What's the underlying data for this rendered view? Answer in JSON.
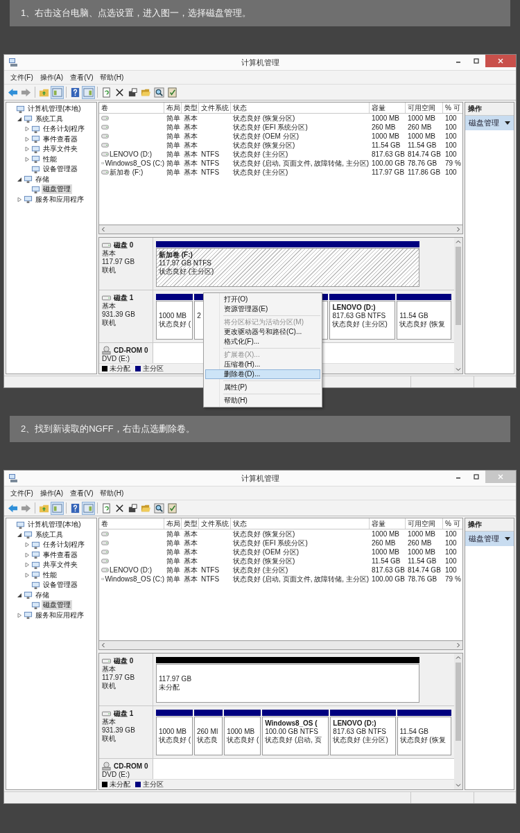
{
  "steps": [
    {
      "instruction": "1、右击这台电脑、点选设置，进入图一，选择磁盘管理。",
      "window": {
        "title": "计算机管理",
        "active": true,
        "menu_bar": [
          "文件(F)",
          "操作(A)",
          "查看(V)",
          "帮助(H)"
        ],
        "tree": [
          {
            "label": "计算机管理(本地)",
            "selected": false,
            "children": [
              {
                "label": "系统工具",
                "selected": false,
                "expanded": true,
                "children": [
                  {
                    "label": "任务计划程序",
                    "selected": false,
                    "expanded": false
                  },
                  {
                    "label": "事件查看器",
                    "selected": false,
                    "expanded": false
                  },
                  {
                    "label": "共享文件夹",
                    "selected": false,
                    "expanded": false
                  },
                  {
                    "label": "性能",
                    "selected": false,
                    "expanded": false
                  },
                  {
                    "label": "设备管理器",
                    "selected": false
                  }
                ]
              },
              {
                "label": "存储",
                "selected": false,
                "expanded": true,
                "children": [
                  {
                    "label": "磁盘管理",
                    "selected": true
                  }
                ]
              },
              {
                "label": "服务和应用程序",
                "selected": false,
                "expanded": false
              }
            ]
          }
        ],
        "volume_table": {
          "columns": [
            "卷",
            "布局",
            "类型",
            "文件系统",
            "状态",
            "容量",
            "可用空间",
            "% 可"
          ],
          "rows": [
            {
              "layout": "简单",
              "type": "基本",
              "status": "状态良好 (恢复分区)",
              "capacity": "1000 MB",
              "free_space": "1000 MB",
              "percent_free": "100"
            },
            {
              "layout": "简单",
              "type": "基本",
              "status": "状态良好 (EFI 系统分区)",
              "capacity": "260 MB",
              "free_space": "260 MB",
              "percent_free": "100"
            },
            {
              "layout": "简单",
              "type": "基本",
              "status": "状态良好 (OEM 分区)",
              "capacity": "1000 MB",
              "free_space": "1000 MB",
              "percent_free": "100"
            },
            {
              "layout": "简单",
              "type": "基本",
              "status": "状态良好 (恢复分区)",
              "capacity": "11.54 GB",
              "free_space": "11.54 GB",
              "percent_free": "100"
            },
            {
              "volume": "LENOVO (D:)",
              "layout": "简单",
              "type": "基本",
              "file_system": "NTFS",
              "status": "状态良好 (主分区)",
              "capacity": "817.63 GB",
              "free_space": "814.74 GB",
              "percent_free": "100"
            },
            {
              "volume": "Windows8_OS (C:)",
              "layout": "简单",
              "type": "基本",
              "file_system": "NTFS",
              "status": "状态良好 (启动, 页面文件, 故障转储, 主分区)",
              "capacity": "100.00 GB",
              "free_space": "78.76 GB",
              "percent_free": "79 %"
            },
            {
              "volume": "新加卷 (F:)",
              "layout": "简单",
              "type": "基本",
              "file_system": "NTFS",
              "status": "状态良好 (主分区)",
              "capacity": "117.97 GB",
              "free_space": "117.86 GB",
              "percent_free": "100"
            }
          ]
        },
        "disks": [
          {
            "kind": "disk",
            "name": "磁盘 0",
            "lines": [
              "基本",
              "117.97 GB",
              "联机"
            ],
            "partitions": [
              {
                "color": "#00007f",
                "selected": true,
                "title": "新加卷  (F:)",
                "lines": [
                  "117.97 GB NTFS",
                  "状态良好 (主分区)"
                ]
              }
            ]
          },
          {
            "kind": "disk",
            "name": "磁盘 1",
            "lines": [
              "基本",
              "931.39 GB",
              "联机"
            ],
            "partitions": [
              {
                "color": "#00007f",
                "selected": false,
                "lines": [
                  "1000 MB",
                  "状态良好 ("
                ]
              },
              {
                "color": "#00007f",
                "selected": false,
                "lines": [
                  "2"
                ]
              },
              {
                "color": "#00007f",
                "selected": false
              },
              {
                "color": "#00007f",
                "selected": false,
                "title": "LENOVO  (D:)",
                "lines": [
                  "817.63 GB NTFS",
                  "状态良好 (主分区)"
                ]
              },
              {
                "color": "#00007f",
                "selected": false,
                "lines": [
                  "11.54 GB",
                  "状态良好 (恢复"
                ]
              }
            ]
          },
          {
            "kind": "cdrom",
            "name": "CD-ROM 0",
            "lines": [
              "DVD (E:)"
            ]
          }
        ],
        "legend": [
          {
            "label": "未分配",
            "color": "#000000"
          },
          {
            "label": "主分区",
            "color": "#00007f"
          }
        ],
        "actions": {
          "header": "操作",
          "item": "磁盘管理"
        },
        "context_menu": {
          "items": [
            {
              "label": "打开(O)",
              "disabled": false,
              "selected": false
            },
            {
              "label": "资源管理器(E)",
              "disabled": false,
              "selected": false,
              "separator_after": true
            },
            {
              "label": "将分区标记为活动分区(M)",
              "disabled": true,
              "selected": false
            },
            {
              "label": "更改驱动器号和路径(C)...",
              "disabled": false,
              "selected": false
            },
            {
              "label": "格式化(F)...",
              "disabled": false,
              "selected": false,
              "separator_after": true
            },
            {
              "label": "扩展卷(X)...",
              "disabled": true,
              "selected": false
            },
            {
              "label": "压缩卷(H)...",
              "disabled": false,
              "selected": false
            },
            {
              "label": "删除卷(D)...",
              "disabled": false,
              "selected": true,
              "separator_after": true
            },
            {
              "label": "属性(P)",
              "disabled": false,
              "selected": false,
              "separator_after": true
            },
            {
              "label": "帮助(H)",
              "disabled": false,
              "selected": false
            }
          ]
        }
      }
    },
    {
      "instruction": "2、找到新读取的NGFF，右击点选删除卷。",
      "window": {
        "title": "计算机管理",
        "active": false,
        "menu_bar": [
          "文件(F)",
          "操作(A)",
          "查看(V)",
          "帮助(H)"
        ],
        "tree": [
          {
            "label": "计算机管理(本地)",
            "selected": false,
            "children": [
              {
                "label": "系统工具",
                "selected": false,
                "expanded": true,
                "children": [
                  {
                    "label": "任务计划程序",
                    "selected": false,
                    "expanded": false
                  },
                  {
                    "label": "事件查看器",
                    "selected": false,
                    "expanded": false
                  },
                  {
                    "label": "共享文件夹",
                    "selected": false,
                    "expanded": false
                  },
                  {
                    "label": "性能",
                    "selected": false,
                    "expanded": false
                  },
                  {
                    "label": "设备管理器",
                    "selected": false
                  }
                ]
              },
              {
                "label": "存储",
                "selected": false,
                "expanded": true,
                "children": [
                  {
                    "label": "磁盘管理",
                    "selected": true
                  }
                ]
              },
              {
                "label": "服务和应用程序",
                "selected": false,
                "expanded": false
              }
            ]
          }
        ],
        "volume_table": {
          "columns": [
            "卷",
            "布局",
            "类型",
            "文件系统",
            "状态",
            "容量",
            "可用空间",
            "% 可"
          ],
          "rows": [
            {
              "layout": "简单",
              "type": "基本",
              "status": "状态良好 (恢复分区)",
              "capacity": "1000 MB",
              "free_space": "1000 MB",
              "percent_free": "100"
            },
            {
              "layout": "简单",
              "type": "基本",
              "status": "状态良好 (EFI 系统分区)",
              "capacity": "260 MB",
              "free_space": "260 MB",
              "percent_free": "100"
            },
            {
              "layout": "简单",
              "type": "基本",
              "status": "状态良好 (OEM 分区)",
              "capacity": "1000 MB",
              "free_space": "1000 MB",
              "percent_free": "100"
            },
            {
              "layout": "简单",
              "type": "基本",
              "status": "状态良好 (恢复分区)",
              "capacity": "11.54 GB",
              "free_space": "11.54 GB",
              "percent_free": "100"
            },
            {
              "volume": "LENOVO (D:)",
              "layout": "简单",
              "type": "基本",
              "file_system": "NTFS",
              "status": "状态良好 (主分区)",
              "capacity": "817.63 GB",
              "free_space": "814.74 GB",
              "percent_free": "100"
            },
            {
              "volume": "Windows8_OS (C:)",
              "layout": "简单",
              "type": "基本",
              "file_system": "NTFS",
              "status": "状态良好 (启动, 页面文件, 故障转储, 主分区)",
              "capacity": "100.00 GB",
              "free_space": "78.76 GB",
              "percent_free": "79 %"
            }
          ]
        },
        "disks": [
          {
            "kind": "disk",
            "name": "磁盘 0",
            "lines": [
              "基本",
              "117.97 GB",
              "联机"
            ],
            "partitions": [
              {
                "color": "#000000",
                "selected": false,
                "lines": [
                  "117.97 GB",
                  "未分配"
                ]
              }
            ]
          },
          {
            "kind": "disk",
            "name": "磁盘 1",
            "lines": [
              "基本",
              "931.39 GB",
              "联机"
            ],
            "partitions": [
              {
                "color": "#00007f",
                "selected": false,
                "lines": [
                  "1000 MB",
                  "状态良好 ("
                ]
              },
              {
                "color": "#00007f",
                "selected": false,
                "lines": [
                  "260 MI",
                  "状态良"
                ]
              },
              {
                "color": "#00007f",
                "selected": false,
                "lines": [
                  "1000 MB",
                  "状态良好 ("
                ]
              },
              {
                "color": "#00007f",
                "selected": false,
                "title": "Windows8_OS  (",
                "lines": [
                  "100.00 GB NTFS",
                  "状态良好 (启动, 页"
                ]
              },
              {
                "color": "#00007f",
                "selected": false,
                "title": "LENOVO  (D:)",
                "lines": [
                  "817.63 GB NTFS",
                  "状态良好 (主分区)"
                ]
              },
              {
                "color": "#00007f",
                "selected": false,
                "lines": [
                  "11.54 GB",
                  "状态良好 (恢复"
                ]
              }
            ]
          },
          {
            "kind": "cdrom",
            "name": "CD-ROM 0",
            "lines": [
              "DVD (E:)"
            ]
          }
        ],
        "legend": [
          {
            "label": "未分配",
            "color": "#000000"
          },
          {
            "label": "主分区",
            "color": "#00007f"
          }
        ],
        "actions": {
          "header": "操作",
          "item": "磁盘管理"
        }
      }
    }
  ]
}
